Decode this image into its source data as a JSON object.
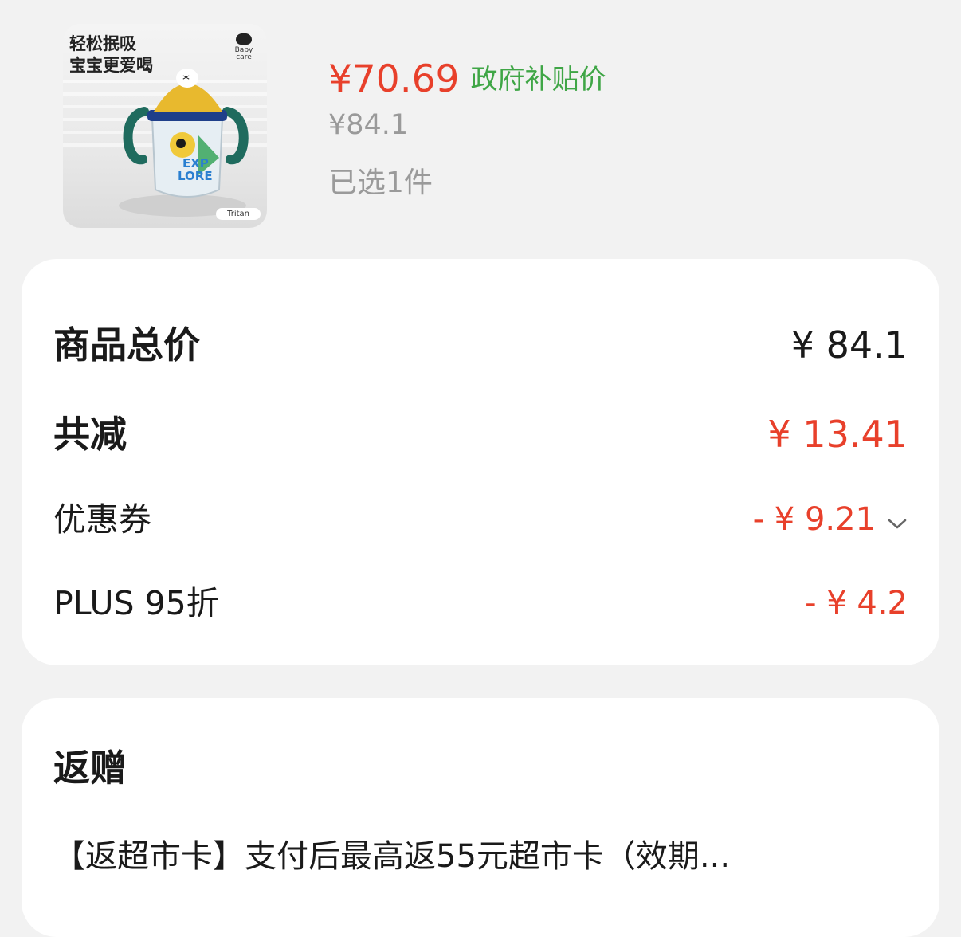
{
  "product": {
    "image_caption_line1": "轻松抿吸",
    "image_caption_line2": "宝宝更爱喝",
    "image_brand": "Baby care",
    "image_badge": "Tritan",
    "image_cup_print": "EXP LORE",
    "sale_price": "¥70.69",
    "sale_price_tag": "政府补贴价",
    "original_price": "¥84.1",
    "selected_count": "已选1件"
  },
  "price_summary": {
    "total_label": "商品总价",
    "total_value": "¥ 84.1",
    "discount_total_label": "共减",
    "discount_total_value": "¥ 13.41",
    "coupon_label": "优惠券",
    "coupon_value": "- ¥ 9.21",
    "plus_label": "PLUS 95折",
    "plus_value": "- ¥ 4.2"
  },
  "gift": {
    "title": "返赠",
    "text": "【返超市卡】支付后最高返55元超市卡（效期..."
  },
  "colors": {
    "accent_red": "#e8402b",
    "subsidy_green": "#3fa646",
    "muted_gray": "#9a9a9a",
    "page_bg": "#f2f2f2"
  },
  "icons": {
    "coupon_expand": "chevron-down-icon"
  }
}
